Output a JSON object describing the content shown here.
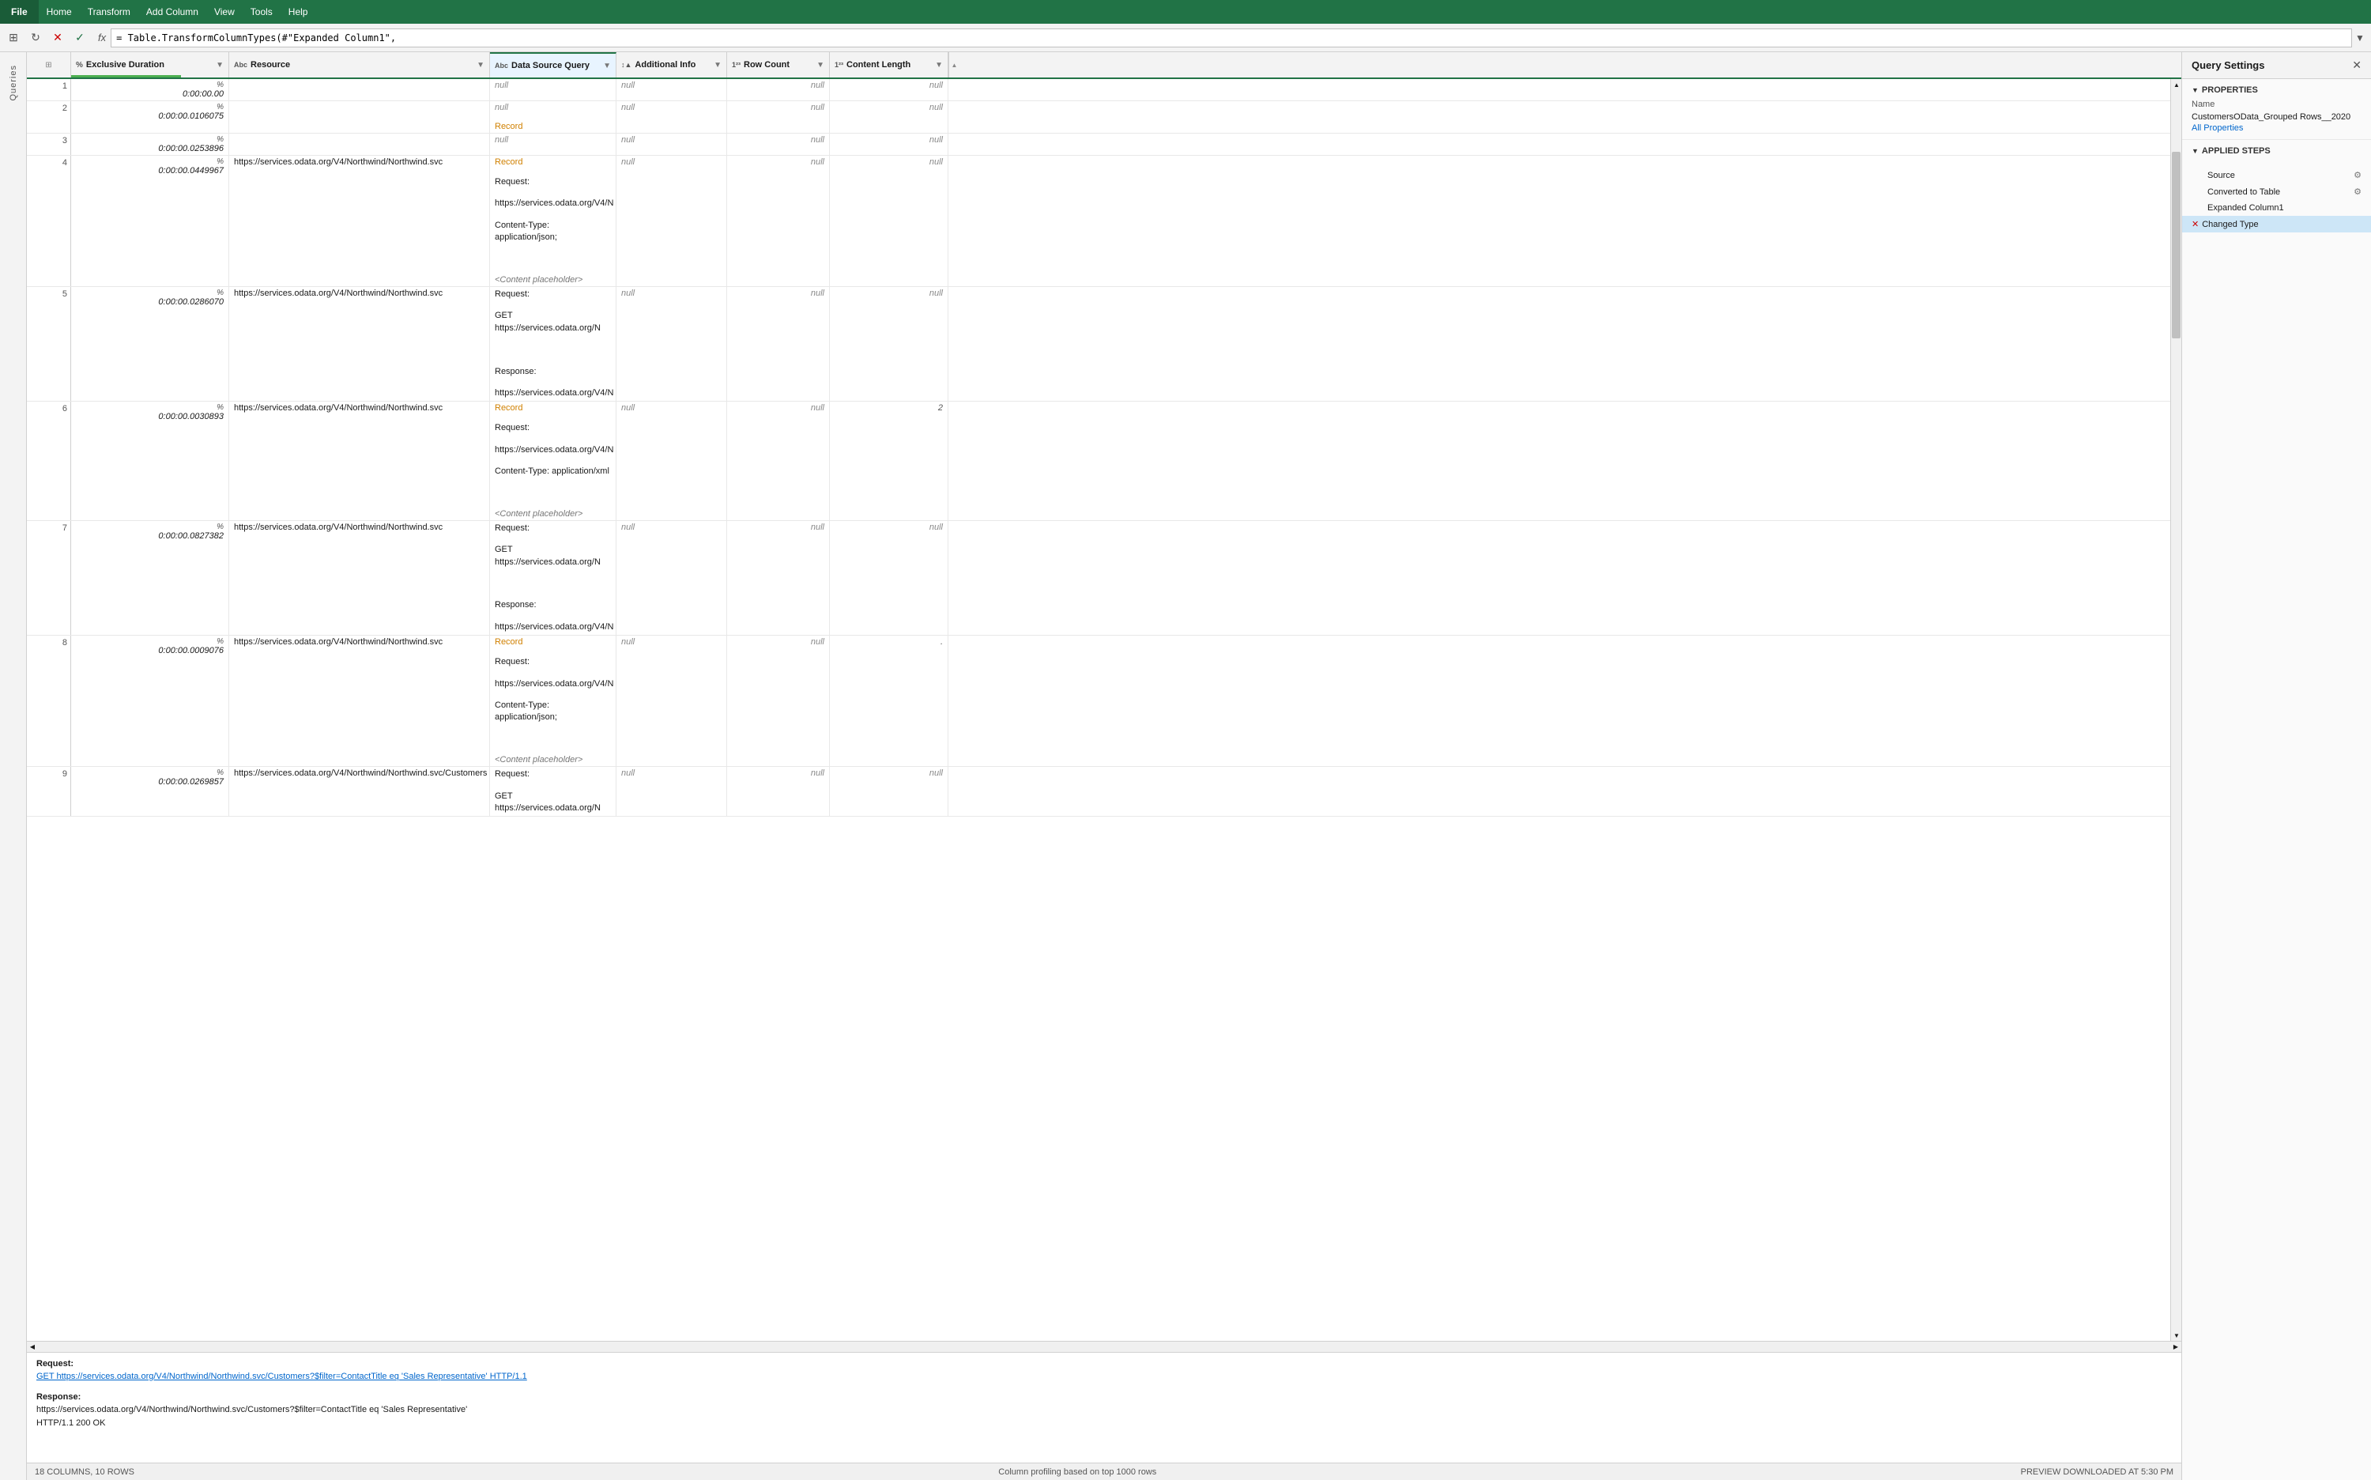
{
  "menubar": {
    "file_label": "File",
    "home_label": "Home",
    "transform_label": "Transform",
    "add_column_label": "Add Column",
    "view_label": "View",
    "tools_label": "Tools",
    "help_label": "Help"
  },
  "formula_bar": {
    "formula": "= Table.TransformColumnTypes(#\"Expanded Column1\","
  },
  "columns": [
    {
      "id": "exclusive",
      "icon": "ABC%",
      "label": "Exclusive Duration",
      "type": "%"
    },
    {
      "id": "resource",
      "icon": "Abc",
      "label": "Resource",
      "type": "text"
    },
    {
      "id": "datasource",
      "icon": "Abc",
      "label": "Data Source Query",
      "type": "text"
    },
    {
      "id": "additional",
      "icon": "123",
      "label": "Additional Info",
      "type": "number"
    },
    {
      "id": "rowcount",
      "icon": "123",
      "label": "Row Count",
      "type": "number"
    },
    {
      "id": "contentlen",
      "icon": "123",
      "label": "Content Length",
      "type": "number"
    }
  ],
  "rows": [
    {
      "num": "1",
      "exclusive": "0:00:00.00",
      "pct": "%",
      "resource": "",
      "datasource": "null",
      "additional": "null",
      "rowcount": "null",
      "contentlen": "null",
      "tall": false
    },
    {
      "num": "2",
      "exclusive": "0:00:00.0106075",
      "pct": "%",
      "resource": "",
      "datasource": "null",
      "datasource_record": "Record",
      "additional": "null",
      "rowcount": "null",
      "contentlen": "null",
      "tall": false
    },
    {
      "num": "3",
      "exclusive": "0:00:00.0253896",
      "pct": "%",
      "resource": "",
      "datasource": "null",
      "additional": "null",
      "rowcount": "null",
      "contentlen": "null",
      "tall": false
    },
    {
      "num": "4",
      "exclusive": "0:00:00.0449967",
      "pct": "%",
      "resource": "https://services.odata.org/V4/Northwind/Northwind.svc",
      "datasource_lines": [
        "Request:",
        "https://services.odata.org/V4/N",
        "Content-Type: application/json;",
        "",
        "<Content placeholder>"
      ],
      "datasource_record": "Record",
      "additional": "null",
      "rowcount": "null",
      "contentlen": "null",
      "tall": true
    },
    {
      "num": "5",
      "exclusive": "0:00:00.0286070",
      "pct": "%",
      "resource": "https://services.odata.org/V4/Northwind/Northwind.svc",
      "datasource_lines": [
        "Request:",
        "GET https://services.odata.org/N",
        "",
        "Response:",
        "https://services.odata.org/V4/N"
      ],
      "additional": "null",
      "rowcount": "null",
      "contentlen": "null",
      "tall": true
    },
    {
      "num": "6",
      "exclusive": "0:00:00.0030893",
      "pct": "%",
      "resource": "https://services.odata.org/V4/Northwind/Northwind.svc",
      "datasource_lines": [
        "Request:",
        "https://services.odata.org/V4/N",
        "Content-Type: application/xml",
        "",
        "<Content placeholder>"
      ],
      "datasource_record": "Record",
      "additional": "null",
      "rowcount": "null",
      "contentlen": "2",
      "tall": true
    },
    {
      "num": "7",
      "exclusive": "0:00:00.0827382",
      "pct": "%",
      "resource": "https://services.odata.org/V4/Northwind/Northwind.svc",
      "datasource_lines": [
        "Request:",
        "GET https://services.odata.org/N",
        "",
        "Response:",
        "https://services.odata.org/V4/N"
      ],
      "additional": "null",
      "rowcount": "null",
      "contentlen": "null",
      "tall": true
    },
    {
      "num": "8",
      "exclusive": "0:00:00.0009076",
      "pct": "%",
      "resource": "https://services.odata.org/V4/Northwind/Northwind.svc",
      "datasource_lines": [
        "Request:",
        "https://services.odata.org/V4/N",
        "Content-Type: application/json;",
        "",
        "<Content placeholder>"
      ],
      "datasource_record": "Record",
      "additional": "null",
      "rowcount": "null",
      "contentlen": ".",
      "tall": true
    },
    {
      "num": "9",
      "exclusive": "0:00:00.0269857",
      "pct": "%",
      "resource": "https://services.odata.org/V4/Northwind/Northwind.svc/Customers",
      "datasource_lines": [
        "Request:",
        "GET https://services.odata.org/N"
      ],
      "additional": "null",
      "rowcount": "null",
      "contentlen": "null",
      "tall": false
    }
  ],
  "preview": {
    "request_label": "Request:",
    "request_url": "GET https://services.odata.org/V4/Northwind/Northwind.svc/Customers?$filter=ContactTitle eq 'Sales Representative' HTTP/1.1",
    "response_label": "Response:",
    "response_url": "https://services.odata.org/V4/Northwind/Northwind.svc/Customers?$filter=ContactTitle eq 'Sales Representative'",
    "response_status": "HTTP/1.1 200 OK"
  },
  "status_bar": {
    "left": "18 COLUMNS, 10 ROWS",
    "middle": "Column profiling based on top 1000 rows",
    "right": "PREVIEW DOWNLOADED AT 5:30 PM"
  },
  "query_settings": {
    "title": "Query Settings",
    "properties_section": "PROPERTIES",
    "name_label": "Name",
    "name_value": "CustomersOData_Grouped Rows__2020",
    "all_properties_link": "All Properties",
    "applied_steps_section": "APPLIED STEPS",
    "steps": [
      {
        "id": "source",
        "label": "Source",
        "has_gear": true,
        "is_delete": false
      },
      {
        "id": "converted",
        "label": "Converted to Table",
        "has_gear": true,
        "is_delete": false
      },
      {
        "id": "expanded",
        "label": "Expanded Column1",
        "has_gear": false,
        "is_delete": false
      },
      {
        "id": "changed",
        "label": "Changed Type",
        "has_gear": false,
        "is_delete": true,
        "active": true
      }
    ]
  },
  "sidebar": {
    "queries_label": "Queries"
  }
}
